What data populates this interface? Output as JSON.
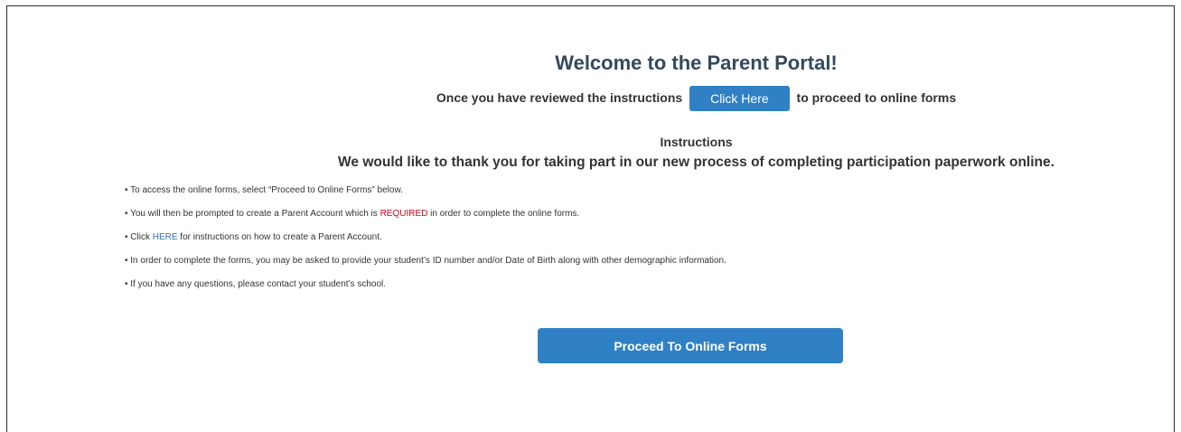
{
  "header": {
    "title": "Welcome to the Parent Portal!",
    "review_prefix": "Once you have reviewed the instructions",
    "click_here_label": "Click Here",
    "review_suffix": "to proceed to online forms"
  },
  "instructions": {
    "heading": "Instructions",
    "thanks": "We would like to thank you for taking part in our new process of completing participation paperwork online.",
    "bullets": [
      {
        "text": "• To access the online forms, select “Proceed to Online Forms” below."
      },
      {
        "before": "• You will then be prompted to create a Parent Account which is ",
        "highlight": "REQUIRED",
        "after": " in order to complete the online forms."
      },
      {
        "before": "• Click ",
        "link": "HERE",
        "after": " for instructions on how to create a Parent Account."
      },
      {
        "text": "• In order to complete the forms, you may be asked to provide your student’s ID number and/or Date of Birth along with other demographic information."
      },
      {
        "text": "• If you have any questions, please contact your student’s school."
      }
    ]
  },
  "actions": {
    "proceed_label": "Proceed To Online Forms"
  },
  "colors": {
    "title": "#34495e",
    "button": "#2f80c4",
    "required": "#d9001b",
    "link": "#2f6fb6"
  }
}
